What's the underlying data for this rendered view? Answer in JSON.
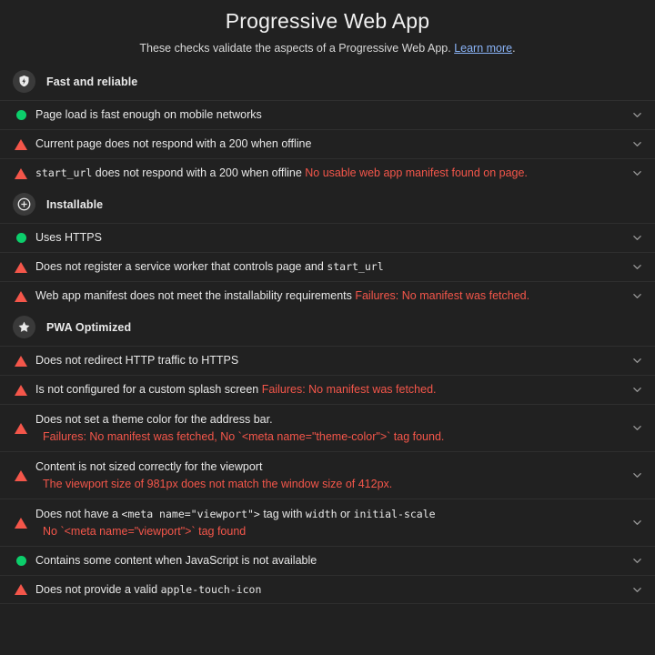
{
  "header": {
    "title": "Progressive Web App",
    "subtitle_before": "These checks validate the aspects of a Progressive Web App.",
    "learn_more": "Learn more",
    "subtitle_after": "."
  },
  "colors": {
    "background": "#212121",
    "pass": "#0cce6b",
    "fail": "#f4564a",
    "link": "#8ab4f8",
    "text": "#e8e8e8",
    "divider": "#2f2f2f",
    "badge_bg": "#3a3a3a"
  },
  "sections": [
    {
      "title": "Fast and reliable",
      "icon": "shield-bolt-icon",
      "rows": [
        {
          "status": "pass",
          "icon": "pass-circle-icon",
          "parts": [
            {
              "text": "Page load is fast enough on mobile networks",
              "style": "plain"
            }
          ],
          "detail": null,
          "chevron": "chevron-down-icon"
        },
        {
          "status": "fail",
          "icon": "fail-triangle-icon",
          "parts": [
            {
              "text": "Current page does not respond with a 200 when offline",
              "style": "plain"
            }
          ],
          "detail": null,
          "chevron": "chevron-down-icon"
        },
        {
          "status": "fail",
          "icon": "fail-triangle-icon",
          "parts": [
            {
              "text": "start_url",
              "style": "mono"
            },
            {
              "text": " does not respond with a 200 when offline ",
              "style": "plain"
            },
            {
              "text": "No usable web app manifest found on page.",
              "style": "fail"
            }
          ],
          "detail": null,
          "chevron": "chevron-down-icon"
        }
      ]
    },
    {
      "title": "Installable",
      "icon": "plus-circle-icon",
      "rows": [
        {
          "status": "pass",
          "icon": "pass-circle-icon",
          "parts": [
            {
              "text": "Uses HTTPS",
              "style": "plain"
            }
          ],
          "detail": null,
          "chevron": "chevron-down-icon"
        },
        {
          "status": "fail",
          "icon": "fail-triangle-icon",
          "parts": [
            {
              "text": "Does not register a service worker that controls page and ",
              "style": "plain"
            },
            {
              "text": "start_url",
              "style": "mono"
            }
          ],
          "detail": null,
          "chevron": "chevron-down-icon"
        },
        {
          "status": "fail",
          "icon": "fail-triangle-icon",
          "parts": [
            {
              "text": "Web app manifest does not meet the installability requirements ",
              "style": "plain"
            },
            {
              "text": "Failures: No manifest was fetched.",
              "style": "fail"
            }
          ],
          "detail": null,
          "chevron": "chevron-down-icon"
        }
      ]
    },
    {
      "title": "PWA Optimized",
      "icon": "star-icon",
      "rows": [
        {
          "status": "fail",
          "icon": "fail-triangle-icon",
          "parts": [
            {
              "text": "Does not redirect HTTP traffic to HTTPS",
              "style": "plain"
            }
          ],
          "detail": null,
          "chevron": "chevron-down-icon"
        },
        {
          "status": "fail",
          "icon": "fail-triangle-icon",
          "parts": [
            {
              "text": "Is not configured for a custom splash screen ",
              "style": "plain"
            },
            {
              "text": "Failures: No manifest was fetched.",
              "style": "fail"
            }
          ],
          "detail": null,
          "chevron": "chevron-down-icon"
        },
        {
          "status": "fail",
          "icon": "fail-triangle-icon",
          "parts": [
            {
              "text": "Does not set a theme color for the address bar.",
              "style": "plain"
            }
          ],
          "detail": [
            {
              "text": "Failures: No manifest was fetched, No `<meta name=\"theme-color\">` tag found.",
              "style": "fail"
            }
          ],
          "chevron": "chevron-down-icon"
        },
        {
          "status": "fail",
          "icon": "fail-triangle-icon",
          "parts": [
            {
              "text": "Content is not sized correctly for the viewport",
              "style": "plain"
            }
          ],
          "detail": [
            {
              "text": "The viewport size of 981px does not match the window size of 412px.",
              "style": "fail"
            }
          ],
          "chevron": "chevron-down-icon"
        },
        {
          "status": "fail",
          "icon": "fail-triangle-icon",
          "parts": [
            {
              "text": "Does not have a ",
              "style": "plain"
            },
            {
              "text": "<meta name=\"viewport\">",
              "style": "mono"
            },
            {
              "text": " tag with ",
              "style": "plain"
            },
            {
              "text": "width",
              "style": "mono"
            },
            {
              "text": " or ",
              "style": "plain"
            },
            {
              "text": "initial-scale",
              "style": "mono"
            }
          ],
          "detail": [
            {
              "text": "No `<meta name=\"viewport\">` tag found",
              "style": "fail"
            }
          ],
          "chevron": "chevron-down-icon"
        },
        {
          "status": "pass",
          "icon": "pass-circle-icon",
          "parts": [
            {
              "text": "Contains some content when JavaScript is not available",
              "style": "plain"
            }
          ],
          "detail": null,
          "chevron": "chevron-down-icon"
        },
        {
          "status": "fail",
          "icon": "fail-triangle-icon",
          "parts": [
            {
              "text": "Does not provide a valid ",
              "style": "plain"
            },
            {
              "text": "apple-touch-icon",
              "style": "mono"
            }
          ],
          "detail": null,
          "chevron": "chevron-down-icon"
        }
      ]
    }
  ]
}
